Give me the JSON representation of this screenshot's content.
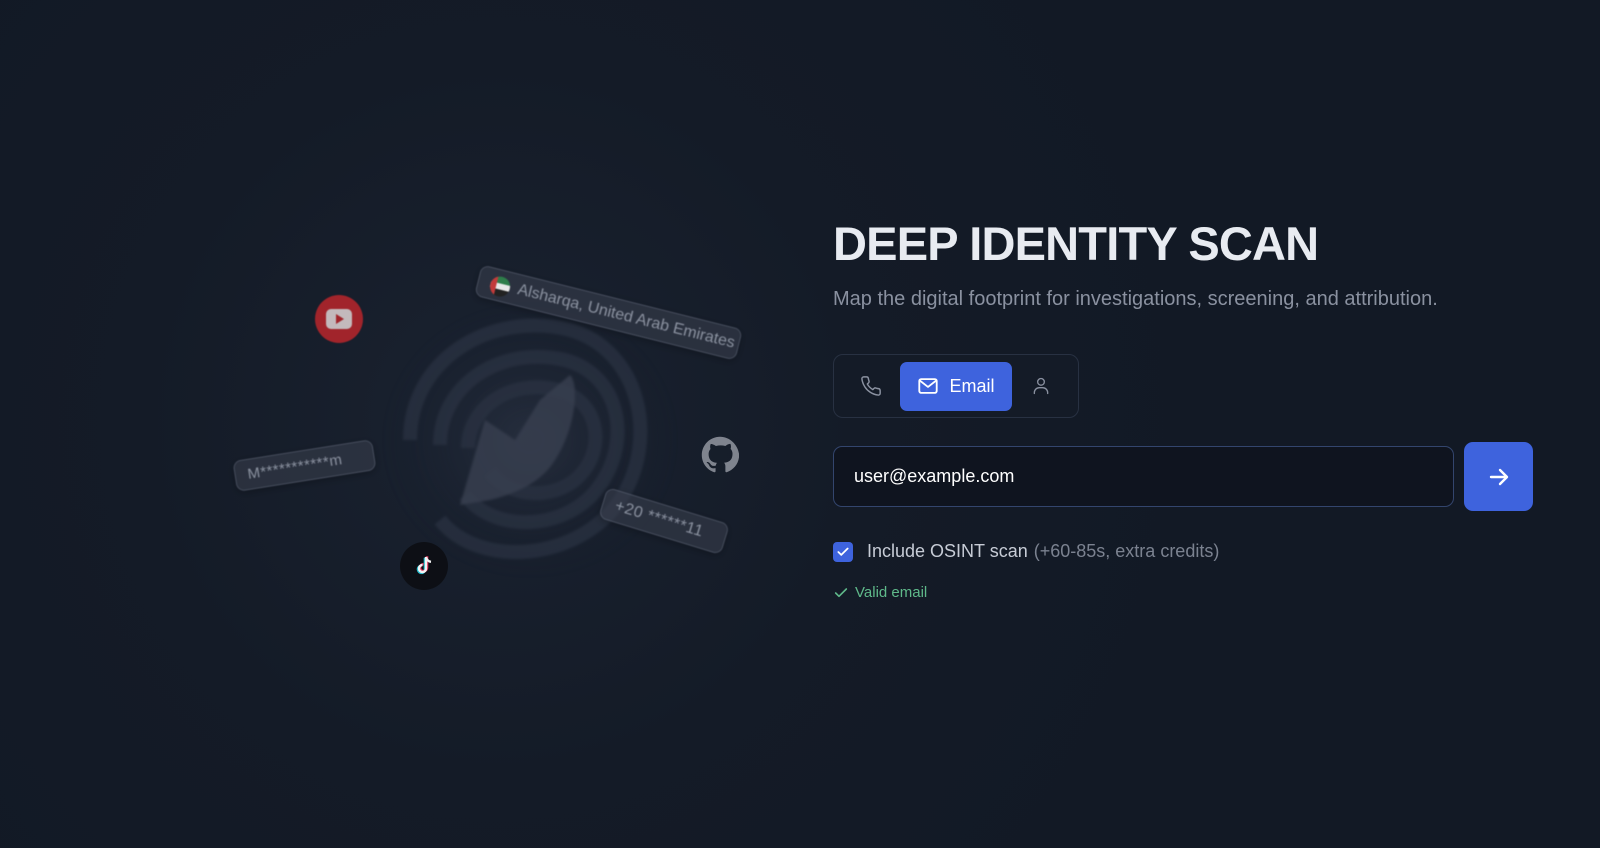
{
  "header": {
    "title": "DEEP IDENTITY SCAN",
    "subtitle": "Map the digital footprint for investigations, screening, and attribution."
  },
  "illustration": {
    "location_chip": "Alsharqa, United Arab Emirates",
    "email_chip": "M***********m",
    "phone_chip": "+20 ******11",
    "socials": [
      "youtube-icon",
      "github-icon",
      "tiktok-icon"
    ]
  },
  "search_type_tabs": {
    "items": [
      {
        "id": "phone",
        "icon": "phone-icon",
        "label": ""
      },
      {
        "id": "email",
        "icon": "mail-icon",
        "label": "Email",
        "active": true
      },
      {
        "id": "person",
        "icon": "user-icon",
        "label": ""
      }
    ]
  },
  "search": {
    "value": "user@example.com",
    "submit_icon": "arrow-right-icon"
  },
  "osint": {
    "checked": true,
    "label": "Include OSINT scan",
    "note": "(+60-85s, extra credits)"
  },
  "validation": {
    "text": "Valid email",
    "icon": "check-icon"
  },
  "colors": {
    "background": "#121925",
    "accent": "#3e63dd",
    "success": "#5fb98a",
    "muted_text": "#8a91a0"
  }
}
